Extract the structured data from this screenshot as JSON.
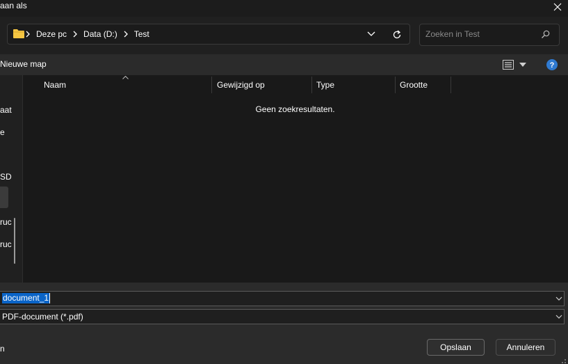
{
  "window": {
    "title": "aan als"
  },
  "address": {
    "crumbs": [
      "Deze pc",
      "Data (D:)",
      "Test"
    ],
    "folder_icon": "folder-icon"
  },
  "search": {
    "placeholder": "Zoeken in Test"
  },
  "toolbar": {
    "new_folder_label": "Nieuwe map"
  },
  "nav_pane": {
    "items": [
      "aat",
      "e",
      "SD",
      "ruc",
      "ruc"
    ]
  },
  "list": {
    "columns": [
      "Naam",
      "Gewijzigd op",
      "Type",
      "Grootte"
    ],
    "empty_message": "Geen zoekresultaten."
  },
  "form": {
    "filename_value": "document_1",
    "filetype_value": "PDF-document (*.pdf)"
  },
  "footer": {
    "hide_folders_label": "n",
    "save_label": "Opslaan",
    "cancel_label": "Annuleren"
  },
  "colors": {
    "accent": "#0a64c8",
    "folder": "#f4c542",
    "help": "#2f7ad1"
  }
}
